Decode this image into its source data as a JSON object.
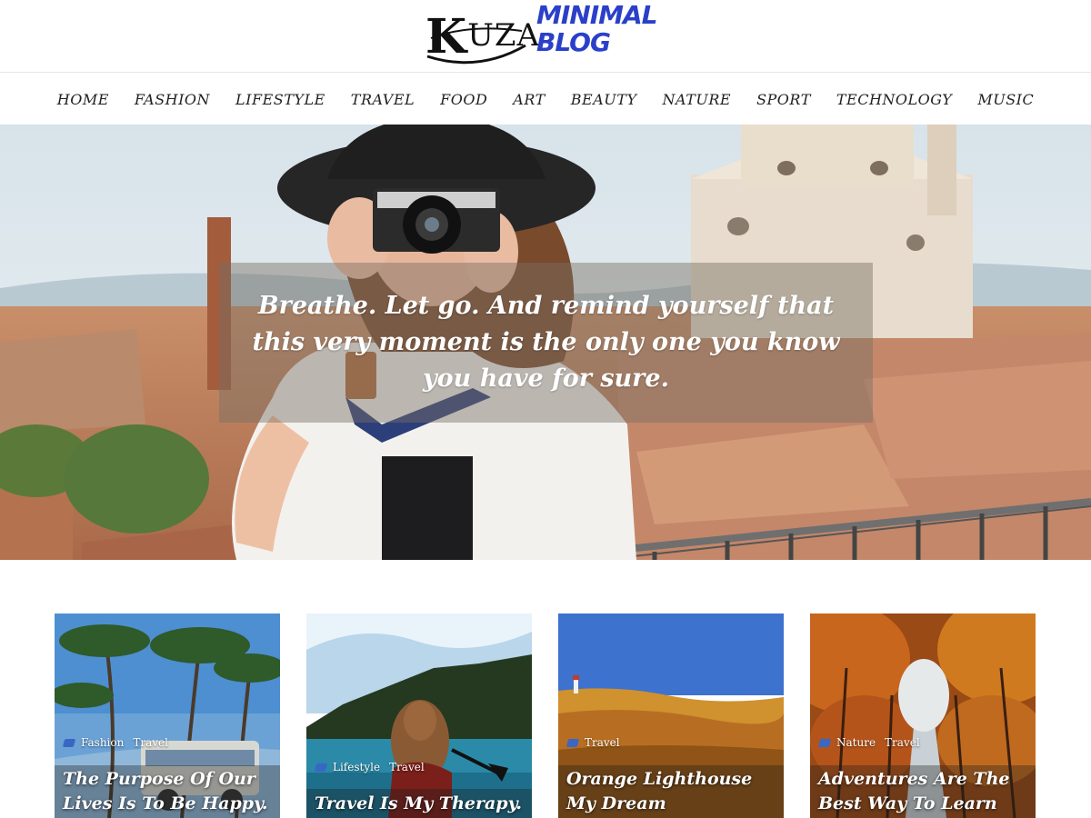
{
  "logo": {
    "brand_big_letter": "K",
    "brand_rest": "UZA",
    "tagline_line1": "MINIMAL",
    "tagline_line2": "BLOG"
  },
  "nav": {
    "items": [
      "HOME",
      "FASHION",
      "LIFESTYLE",
      "TRAVEL",
      "FOOD",
      "ART",
      "BEAUTY",
      "NATURE",
      "SPORT",
      "TECHNOLOGY",
      "MUSIC"
    ]
  },
  "hero": {
    "quote": "Breathe. Let go. And remind yourself that this very moment is the only one you know you have for sure."
  },
  "cards": [
    {
      "tags": [
        "Fashion",
        "Travel"
      ],
      "title": "The Purpose Of Our Lives Is To Be Happy."
    },
    {
      "tags": [
        "Lifestyle",
        "Travel"
      ],
      "title": "Travel Is My Therapy."
    },
    {
      "tags": [
        "Travel"
      ],
      "title": "Orange Lighthouse My Dream"
    },
    {
      "tags": [
        "Nature",
        "Travel"
      ],
      "title": "Adventures Are The Best Way To Learn"
    }
  ],
  "colors": {
    "brand_blue": "#2b40c9",
    "tag_icon": "#3a66c4"
  },
  "icons": {
    "tag_icon": "tag-icon"
  }
}
